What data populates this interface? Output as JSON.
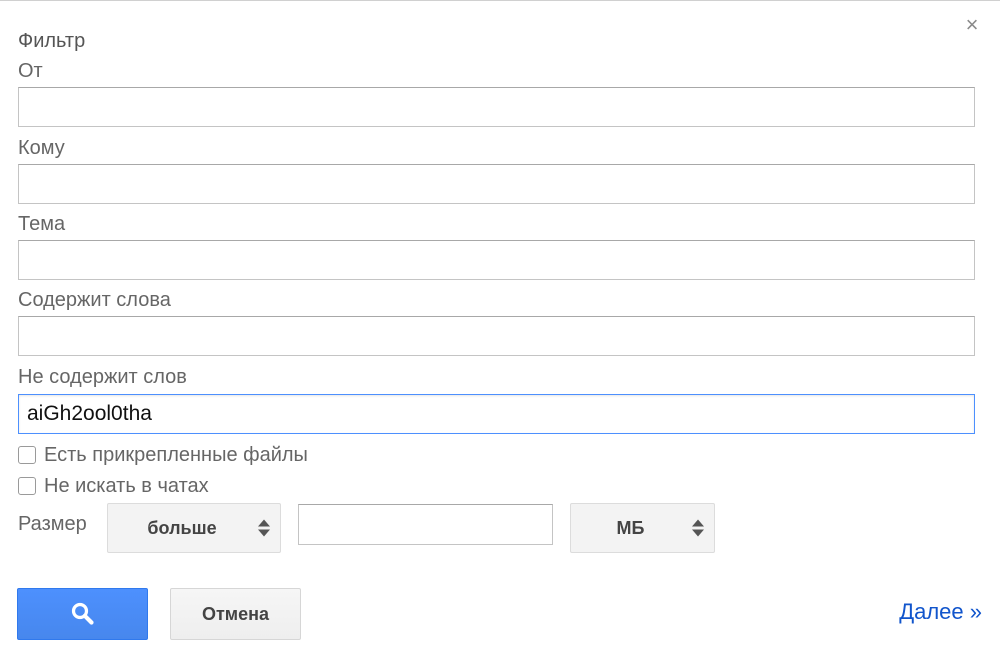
{
  "dialog": {
    "title": "Фильтр",
    "close_symbol": "×"
  },
  "fields": {
    "from": {
      "label": "От",
      "value": ""
    },
    "to": {
      "label": "Кому",
      "value": ""
    },
    "subject": {
      "label": "Тема",
      "value": ""
    },
    "has_words": {
      "label": "Содержит слова",
      "value": ""
    },
    "doesnt_have": {
      "label": "Не содержит слов",
      "value": "aiGh2ool0tha"
    }
  },
  "checkboxes": {
    "has_attachment": {
      "label": "Есть прикрепленные файлы",
      "checked": false
    },
    "dont_search_chats": {
      "label": "Не искать в чатах",
      "checked": false
    }
  },
  "size": {
    "label": "Размер",
    "operator": "больше",
    "value": "",
    "unit": "МБ"
  },
  "actions": {
    "search_icon": "search-icon",
    "cancel_label": "Отмена",
    "next_label": "Далее »"
  },
  "colors": {
    "primary_button": "#4d90fe",
    "link": "#1155cc",
    "focus_border": "#4d90fe"
  }
}
